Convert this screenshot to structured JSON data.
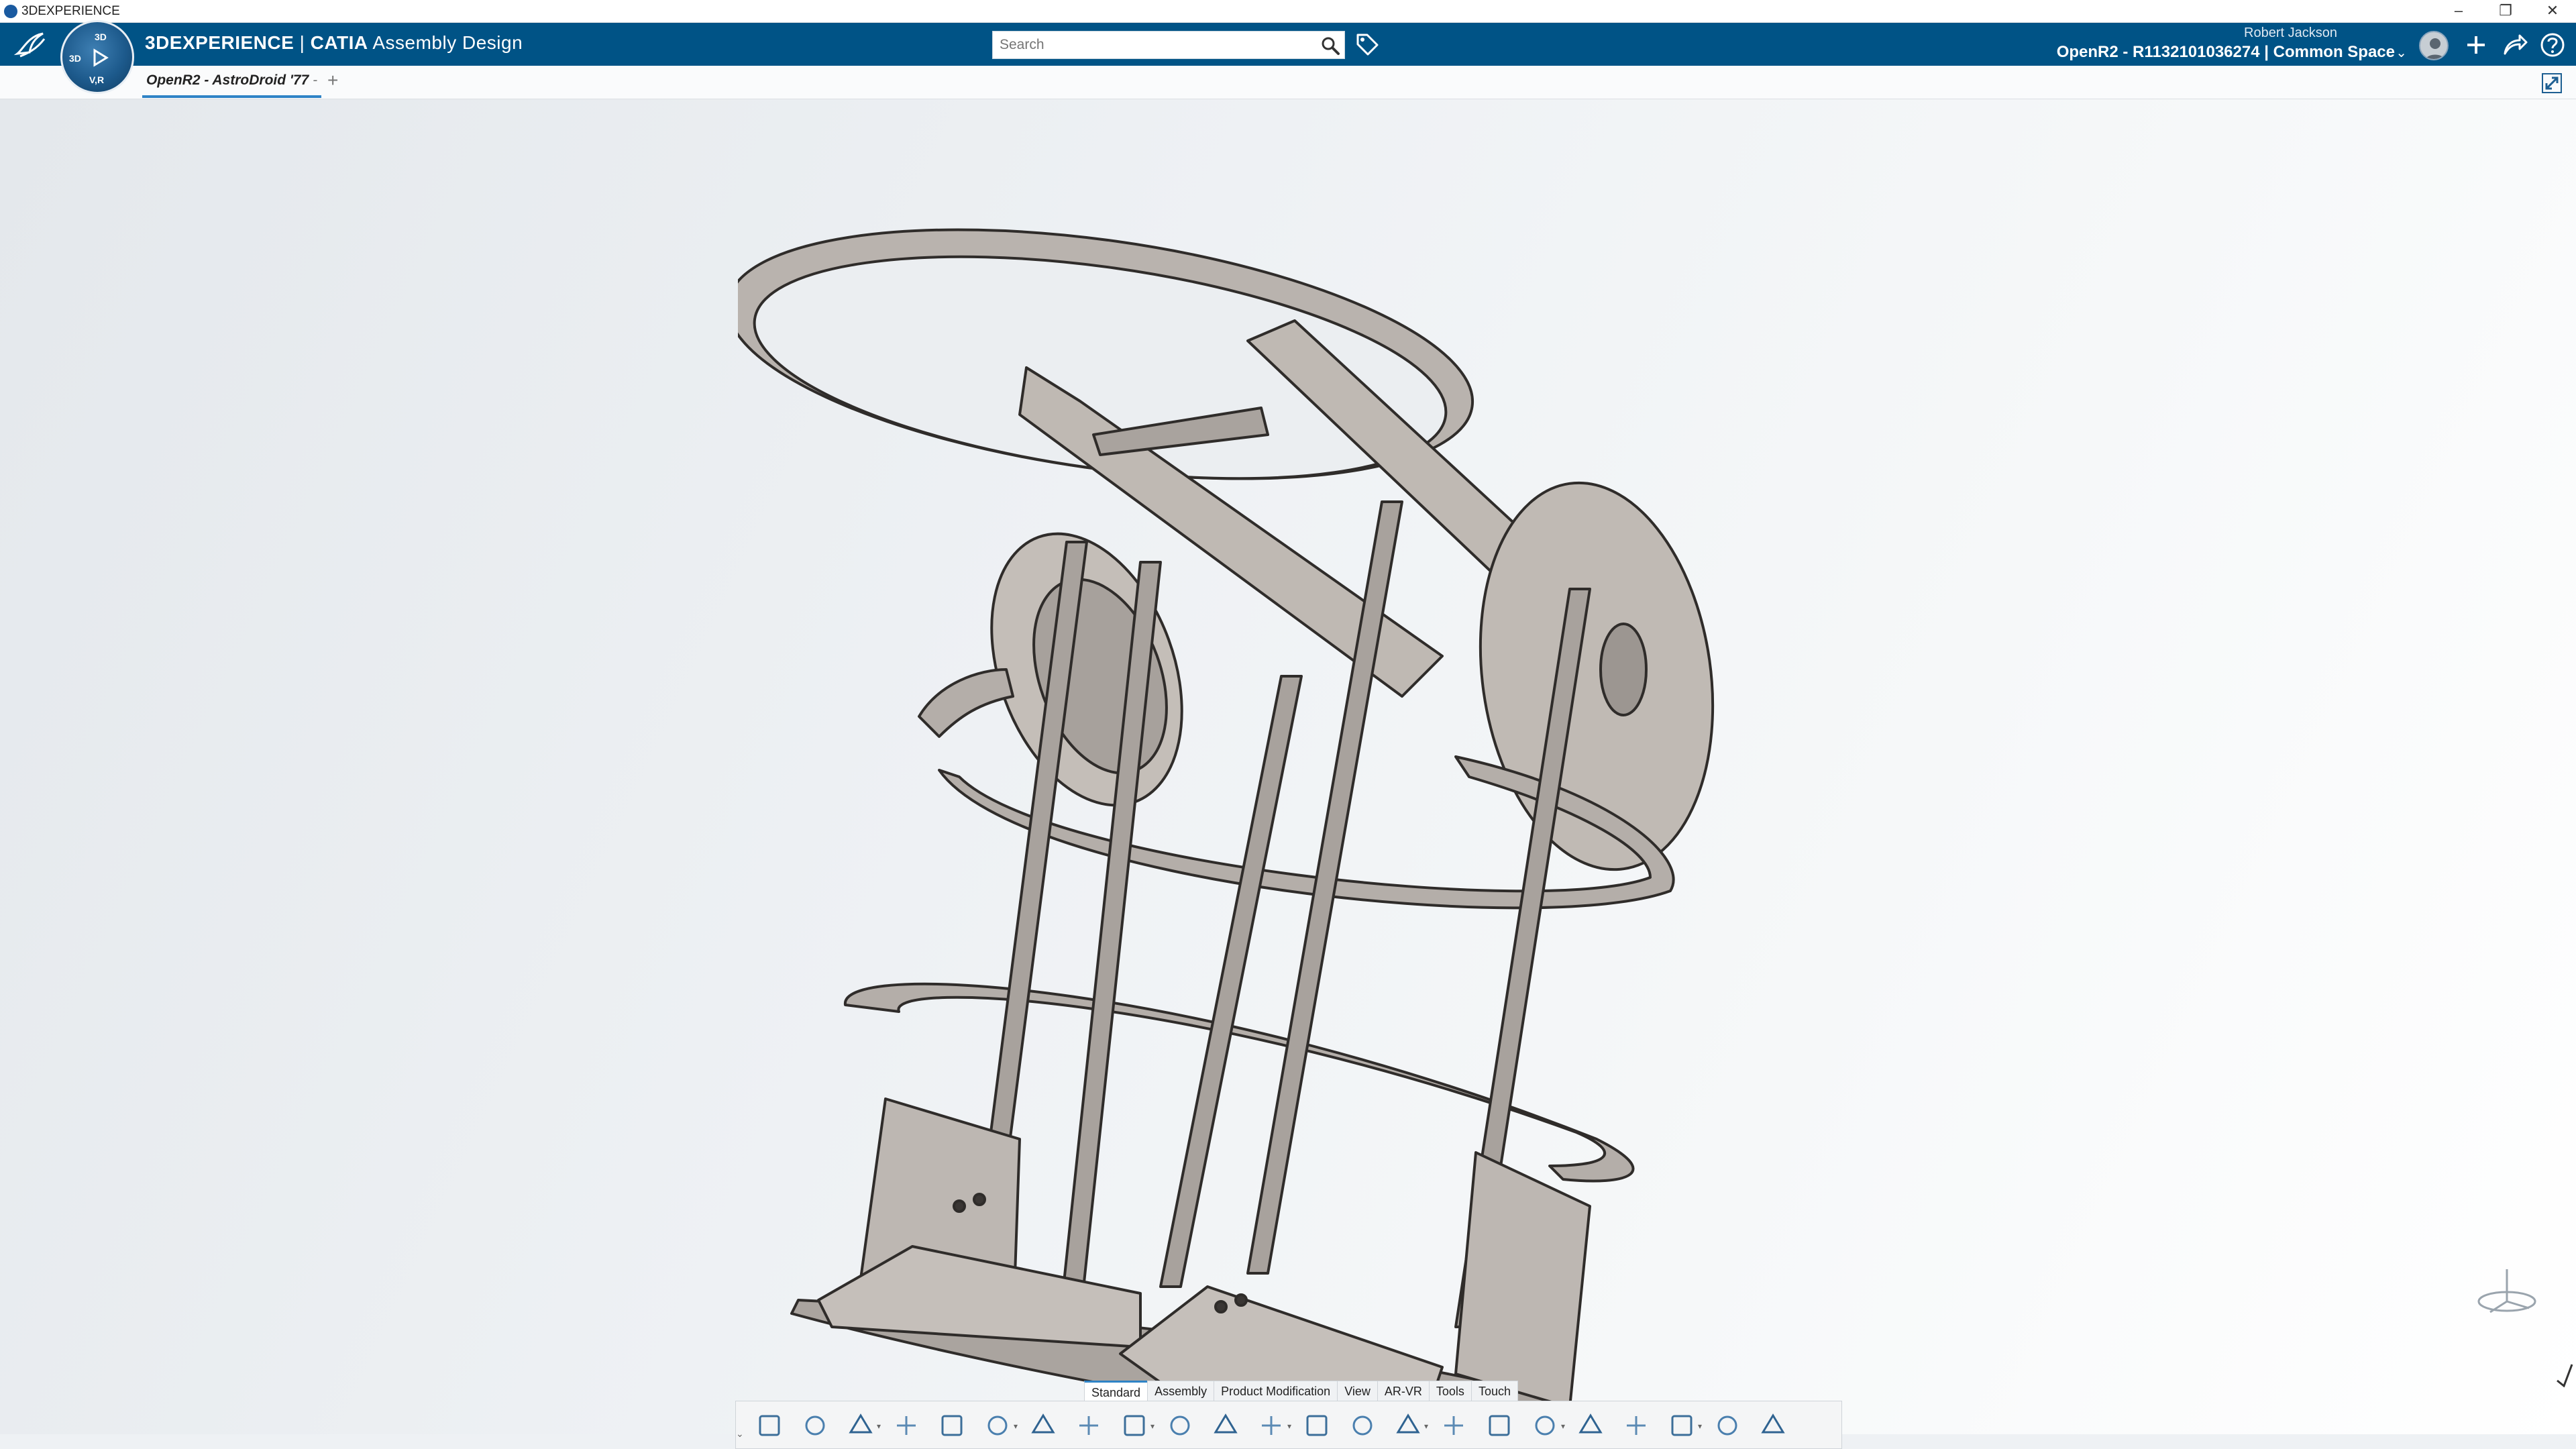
{
  "os_titlebar": {
    "title": "3DEXPERIENCE"
  },
  "header": {
    "compass_labels": {
      "top": "3D",
      "left": "3D",
      "bottom": "V,R"
    },
    "app_brand": "3DEXPERIENCE",
    "app_separator": " | ",
    "app_product": "CATIA",
    "app_role": "Assembly Design",
    "search": {
      "placeholder": "Search",
      "value": ""
    },
    "user_name": "Robert Jackson",
    "tenant": "OpenR2 - R1132101036274 | Common Space"
  },
  "tabs": {
    "document": "OpenR2 - AstroDroid '77",
    "dirty_marker": "-"
  },
  "action_bar": {
    "tabs": [
      "Standard",
      "Assembly",
      "Product Modification",
      "View",
      "AR-VR",
      "Tools",
      "Touch"
    ],
    "active_tab": "Standard",
    "tools": [
      "cut-icon",
      "copy-icon",
      "paste-icon",
      "undo-icon",
      "update-icon",
      "zoom-icon",
      "view-cube-icon",
      "fit-all-icon",
      "pan-icon",
      "rotate-icon",
      "zoom-area-icon",
      "fly-icon",
      "render-style-icon",
      "hide-show-icon",
      "material-icon",
      "capture-icon",
      "visibility-icon",
      "lighting-icon",
      "section-icon",
      "sync-icon",
      "layout-icon",
      "tree-icon",
      "structure-icon"
    ]
  },
  "colors": {
    "header_bg": "#005386",
    "accent": "#2f83c6",
    "part_face": "#b9b3ae",
    "part_edge": "#2f2c2a",
    "viewport_bg": "#eef1f4"
  }
}
